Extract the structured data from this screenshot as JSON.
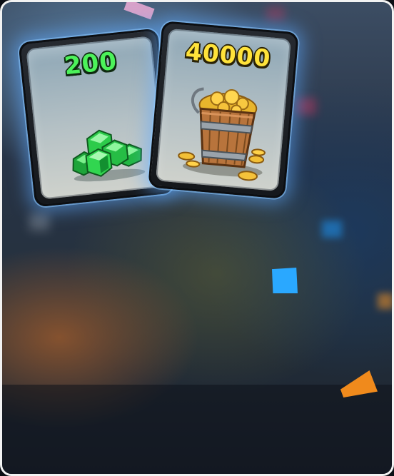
{
  "rewards": [
    {
      "id": "gems",
      "amount": "200",
      "icon": "gems-icon",
      "color": "#4cf25a"
    },
    {
      "id": "gold",
      "amount": "40000",
      "icon": "gold-bucket-icon",
      "color": "#ffe33a"
    }
  ],
  "colors": {
    "frame_border": "#f2f2f2",
    "card_glow": "#5faaff",
    "confetti_blue": "#2aa8ff",
    "confetti_orange": "#f08a1c"
  }
}
